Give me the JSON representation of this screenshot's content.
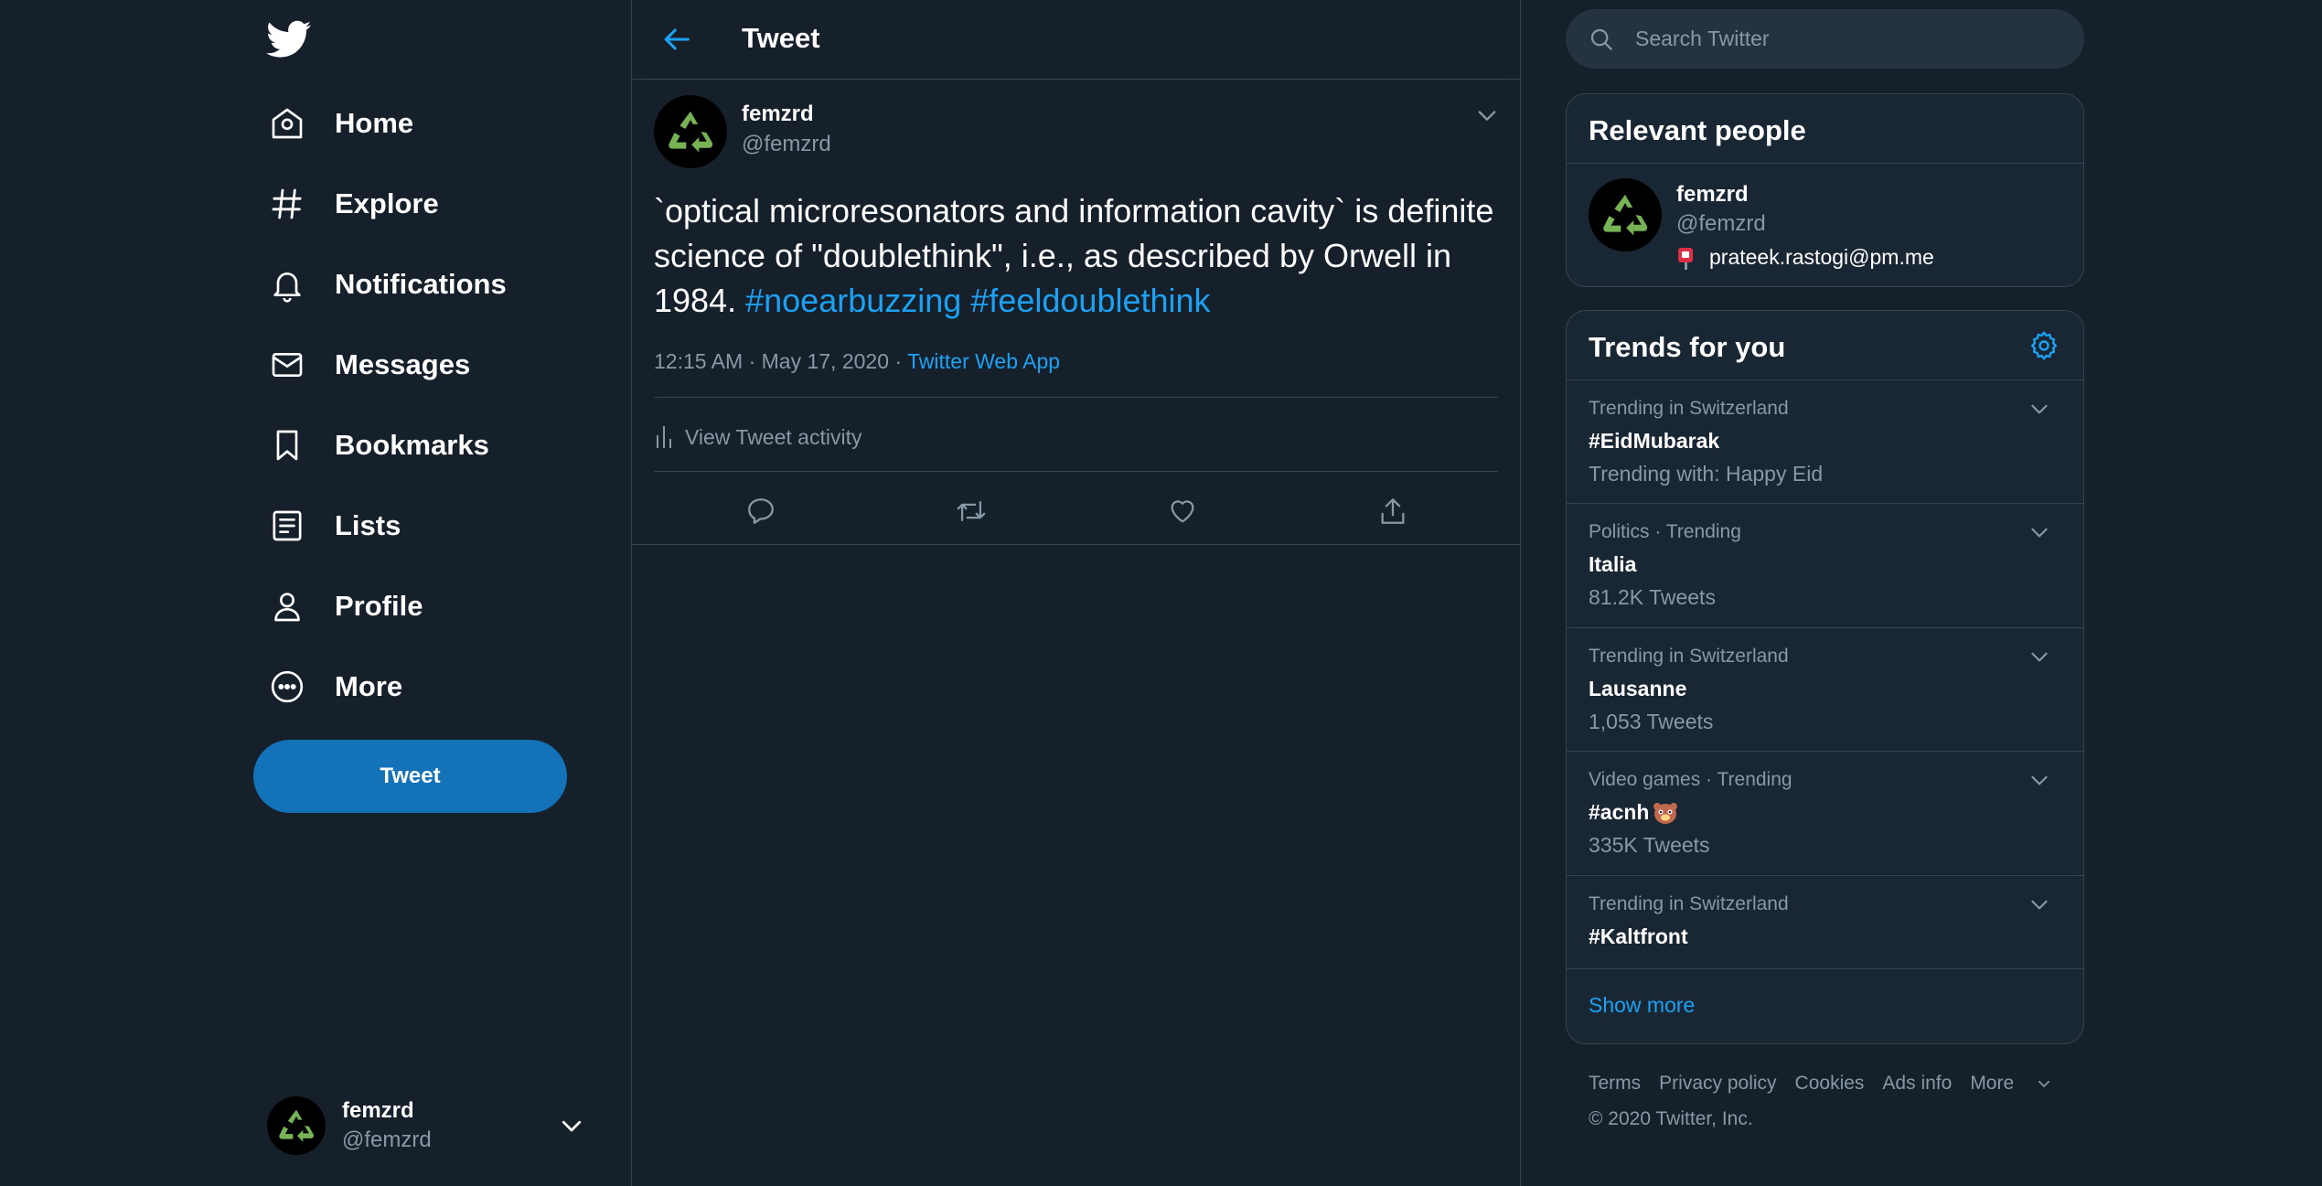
{
  "nav": {
    "logo_icon": "twitter-bird-icon",
    "items": [
      {
        "label": "Home",
        "icon": "home-icon"
      },
      {
        "label": "Explore",
        "icon": "hashtag-icon"
      },
      {
        "label": "Notifications",
        "icon": "bell-icon"
      },
      {
        "label": "Messages",
        "icon": "envelope-icon"
      },
      {
        "label": "Bookmarks",
        "icon": "bookmark-icon"
      },
      {
        "label": "Lists",
        "icon": "list-icon"
      },
      {
        "label": "Profile",
        "icon": "person-icon"
      },
      {
        "label": "More",
        "icon": "more-circle-icon"
      }
    ],
    "tweet_button": "Tweet",
    "account": {
      "name": "femzrd",
      "handle": "@femzrd"
    }
  },
  "header": {
    "title": "Tweet"
  },
  "tweet": {
    "author_name": "femzrd",
    "author_handle": "@femzrd",
    "text": "`optical microresonators and information cavity` is definite science of \"doublethink\", i.e., as described by Orwell in 1984.",
    "hashtags": [
      "#noearbuzzing",
      "#feeldoublethink"
    ],
    "time": "12:15 AM · May 17, 2020 · ",
    "source": "Twitter Web App",
    "activity_label": "View Tweet activity"
  },
  "search": {
    "placeholder": "Search Twitter"
  },
  "relevant_people": {
    "title": "Relevant people",
    "person": {
      "name": "femzrd",
      "handle": "@femzrd",
      "bio": "prateek.rastogi@pm.me"
    }
  },
  "trends": {
    "title": "Trends for you",
    "items": [
      {
        "context": "Trending in Switzerland",
        "topic": "#EidMubarak",
        "sub": "Trending with: Happy Eid"
      },
      {
        "context": "Politics · Trending",
        "topic": "Italia",
        "sub": "81.2K Tweets"
      },
      {
        "context": "Trending in Switzerland",
        "topic": "Lausanne",
        "sub": "1,053 Tweets"
      },
      {
        "context": "Video games · Trending",
        "topic": "#acnh",
        "emoji": "🐻",
        "sub": "335K Tweets"
      },
      {
        "context": "Trending in Switzerland",
        "topic": "#Kaltfront",
        "sub": ""
      }
    ],
    "show_more": "Show more"
  },
  "footer": {
    "links": [
      "Terms",
      "Privacy policy",
      "Cookies",
      "Ads info",
      "More"
    ],
    "copyright": "© 2020 Twitter, Inc."
  },
  "colors": {
    "background": "#15202b",
    "accent": "#1da1f2",
    "muted": "#8899a6",
    "border": "#38444d",
    "recycle_green": "#77b255"
  }
}
